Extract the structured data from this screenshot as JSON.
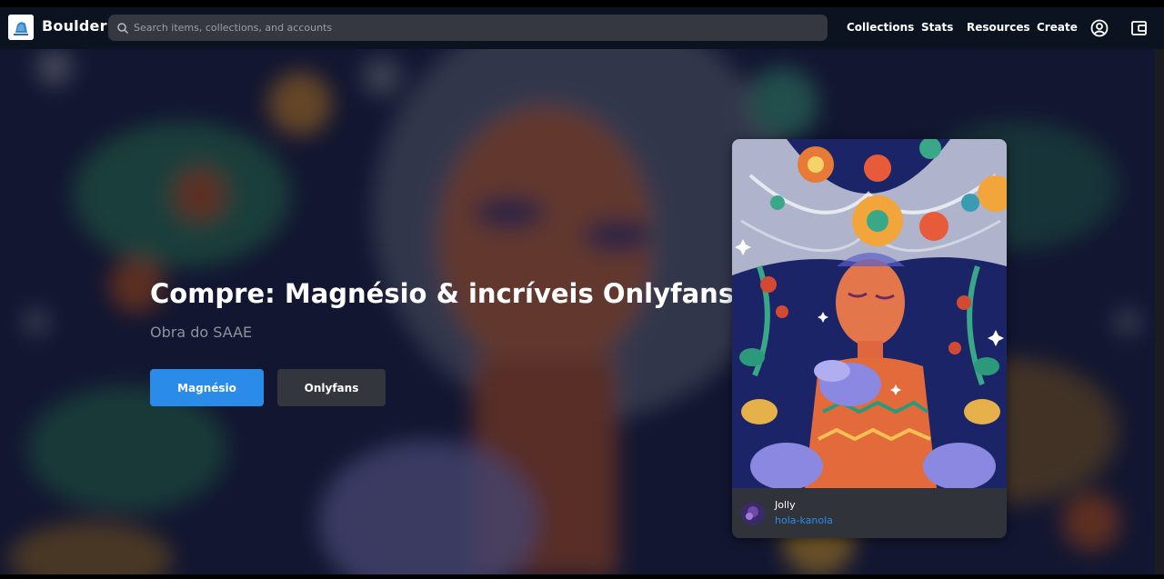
{
  "brand": {
    "name": "Boulder",
    "logo_icon": "boulder-logo-icon"
  },
  "search": {
    "placeholder": "Search items, collections, and accounts",
    "icon": "search-icon"
  },
  "nav": {
    "links": [
      "Collections",
      "Stats",
      "Resources",
      "Create"
    ],
    "icons": [
      "profile-icon",
      "wallet-icon"
    ]
  },
  "hero": {
    "title": "Compre: Magnésio & incríveis Onlyfans",
    "subtitle": "Obra do SAAE",
    "primary_button": "Magnésio",
    "secondary_button": "Onlyfans"
  },
  "featured_card": {
    "title": "Jolly",
    "creator": "hola-kanola",
    "avatar_icon": "creator-avatar"
  },
  "colors": {
    "accent": "#2a8ce8",
    "navbar": "#0b1220",
    "search_bg": "#353841",
    "secondary_button": "#34363d",
    "card_bg": "#303339",
    "subtitle": "#8f929b"
  }
}
